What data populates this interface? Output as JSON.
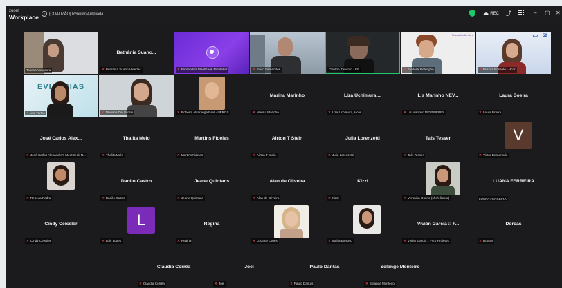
{
  "app": {
    "logo_line1": "zoom",
    "logo_line2": "Workplace"
  },
  "meeting": {
    "title": "[COALIZÃO] Reunião Ampliada"
  },
  "toolbar": {
    "rec_label": "REC",
    "minimize": "–",
    "restore": "▢",
    "close": "✕"
  },
  "tiles": [
    {
      "display": "",
      "label": "Tatiana Yonezura",
      "mic_muted": false,
      "video": true
    },
    {
      "display": "Bethânia Suano...",
      "label": "Bethânia Suano Veredas",
      "mic_muted": true,
      "video": false
    },
    {
      "display": "",
      "label": "Fernando's MeetGeek Notetaker",
      "mic_muted": true,
      "video": true
    },
    {
      "display": "",
      "label": "Silvio Fernandes",
      "mic_muted": true,
      "video": true
    },
    {
      "display": "",
      "label": "Cleyton Zanardo - EF",
      "mic_muted": false,
      "video": true
    },
    {
      "display": "",
      "label": "Frederik Delerighe",
      "mic_muted": true,
      "video": true
    },
    {
      "display": "",
      "label": "Priscila Rosseto - Hcor",
      "mic_muted": true,
      "video": true
    },
    {
      "display": "",
      "label": "Liza Tartas",
      "mic_muted": false,
      "video": true
    },
    {
      "display": "",
      "label": "Mariana Del Grossi",
      "mic_muted": true,
      "video": true
    },
    {
      "display": "",
      "label": "Roberta Alvarenga Reis - UFRGS",
      "mic_muted": true,
      "video": true
    },
    {
      "display": "Marina Marinho",
      "label": "Marina Marinho",
      "mic_muted": true,
      "video": false
    },
    {
      "display": "Liza Uchimura,...",
      "label": "Liza Uchimura, Hcor",
      "mic_muted": true,
      "video": false
    },
    {
      "display": "Lis Marinho NEV...",
      "label": "Lis Marinho NEVNUEPES",
      "mic_muted": true,
      "video": false
    },
    {
      "display": "Laura Boeira",
      "label": "Laura Boeira",
      "mic_muted": true,
      "video": false
    },
    {
      "display": "José Carlos Alex...",
      "label": "José Carlos Alexandre's MeetGeek N...",
      "mic_muted": true,
      "video": false
    },
    {
      "display": "Thalita Melo",
      "label": "Thalita Melo",
      "mic_muted": true,
      "video": false
    },
    {
      "display": "Martins Fideles",
      "label": "Martins Fideles",
      "mic_muted": true,
      "video": false
    },
    {
      "display": "Airton T Stein",
      "label": "Airton T Stein",
      "mic_muted": true,
      "video": false
    },
    {
      "display": "Julia Lorenzetti",
      "label": "Julia Lorenzetti",
      "mic_muted": true,
      "video": false
    },
    {
      "display": "Taís Tesser",
      "label": "Taís Tesser",
      "mic_muted": true,
      "video": false
    },
    {
      "display": "",
      "label": "Victor Damarindo",
      "mic_muted": true,
      "video": false,
      "avatar": "V"
    },
    {
      "display": "",
      "label": "Rebeca Pedra",
      "mic_muted": true,
      "video": false
    },
    {
      "display": "Danilo Castro",
      "label": "Danilo Castro",
      "mic_muted": true,
      "video": false
    },
    {
      "display": "Jeane Quintans",
      "label": "Jeane Quintans",
      "mic_muted": true,
      "video": false
    },
    {
      "display": "Alan de Oliveira",
      "label": "Alan de Oliveira",
      "mic_muted": true,
      "video": false
    },
    {
      "display": "Kizzi",
      "label": "Kizzi",
      "mic_muted": true,
      "video": false
    },
    {
      "display": "",
      "label": "Veronica Osorio (she/ella/ela)",
      "mic_muted": true,
      "video": false
    },
    {
      "display": "LUANA FERREIRA",
      "label": "LUANA FERREIRA",
      "mic_muted": false,
      "video": false
    },
    {
      "display": "Cindy Ceissler",
      "label": "Cindy Ceissler",
      "mic_muted": true,
      "video": false
    },
    {
      "display": "",
      "label": "Luis Lopes",
      "mic_muted": true,
      "video": false,
      "avatar": "L"
    },
    {
      "display": "Regina",
      "label": "Regina",
      "mic_muted": true,
      "video": false
    },
    {
      "display": "",
      "label": "Luciane Lopes",
      "mic_muted": true,
      "video": false
    },
    {
      "display": "",
      "label": "Maíra Barroso",
      "mic_muted": true,
      "video": false
    },
    {
      "display": "Vivian Garcia :: F...",
      "label": "Vivian Garcia :: FGV Projetos",
      "mic_muted": true,
      "video": false
    },
    {
      "display": "Dorcas",
      "label": "Dorcas",
      "mic_muted": true,
      "video": false
    },
    {
      "display": "Claudia Corrêa",
      "label": "Claudia Corrêa",
      "mic_muted": true,
      "video": false
    },
    {
      "display": "Joel",
      "label": "Joel",
      "mic_muted": true,
      "video": false
    },
    {
      "display": "Paulo Dantas",
      "label": "Paulo Dantas",
      "mic_muted": true,
      "video": false
    },
    {
      "display": "Solange Monteiro",
      "label": "Solange Monteiro",
      "mic_muted": true,
      "video": false
    }
  ],
  "overlay_text": {
    "liza_bg": "EVI..NCIAS",
    "hcor_brand": "hcor",
    "hcor_number": "50",
    "frederik_brand": "Prisma Health Care"
  },
  "colors": {
    "active_speaker_border": "#1ec96b",
    "avatar_v": "#5b3a2e",
    "avatar_l": "#7a2bb8",
    "shield": "#1ec96b"
  },
  "icons": [
    "shield-icon",
    "cloud-record-icon",
    "share-icon",
    "grid-view-icon",
    "minimize-icon",
    "restore-icon",
    "close-icon",
    "mic-muted-icon"
  ]
}
